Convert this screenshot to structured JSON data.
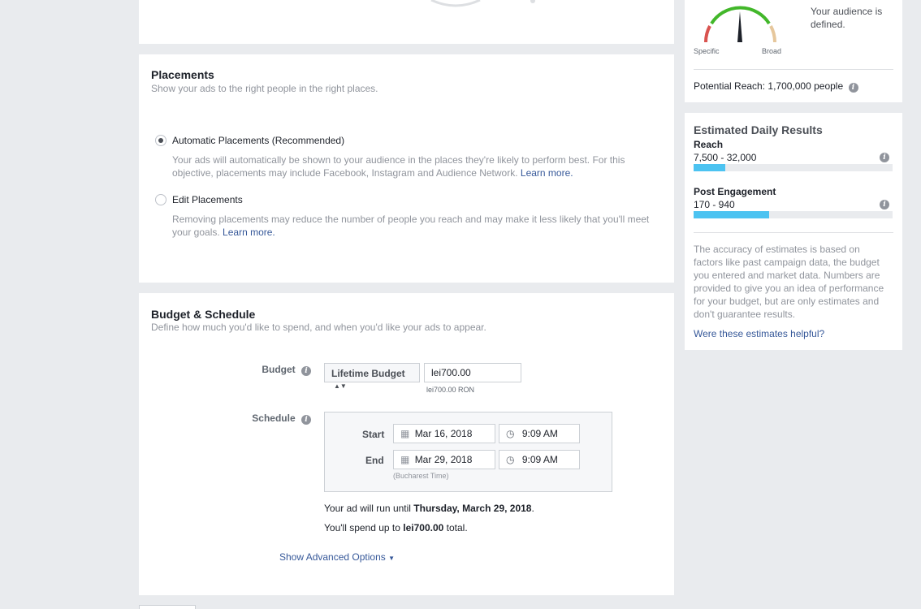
{
  "placements": {
    "title": "Placements",
    "subtitle": "Show your ads to the right people in the right places.",
    "options": [
      {
        "label": "Automatic Placements (Recommended)",
        "description": "Your ads will automatically be shown to your audience in the places they're likely to perform best. For this objective, placements may include Facebook, Instagram and Audience Network.",
        "link": "Learn more.",
        "selected": true
      },
      {
        "label": "Edit Placements",
        "description": "Removing placements may reduce the number of people you reach and may make it less likely that you'll meet your goals.",
        "link": "Learn more.",
        "selected": false
      }
    ]
  },
  "budget_schedule": {
    "title": "Budget & Schedule",
    "subtitle": "Define how much you'd like to spend, and when you'd like your ads to appear.",
    "budget_label": "Budget",
    "budget_type": "Lifetime Budget",
    "budget_value": "lei700.00",
    "budget_hint": "lei700.00 RON",
    "schedule_label": "Schedule",
    "start_label": "Start",
    "start_date": "Mar 16, 2018",
    "start_time": "9:09 AM",
    "end_label": "End",
    "end_date": "Mar 29, 2018",
    "end_time": "9:09 AM",
    "timezone": "(Bucharest Time)",
    "run_prefix": "Your ad will run until ",
    "run_date": "Thursday, March 29, 2018",
    "run_suffix": ".",
    "spend_prefix": "You'll spend up to ",
    "spend_value": "lei700.00",
    "spend_suffix": " total.",
    "advanced": "Show Advanced Options"
  },
  "audience": {
    "defined_text": "Your audience is defined.",
    "gauge_left": "Specific",
    "gauge_right": "Broad",
    "potential_reach": "Potential Reach: 1,700,000 people"
  },
  "estimates": {
    "title": "Estimated Daily Results",
    "metrics": [
      {
        "label": "Reach",
        "range": "7,500 - 32,000",
        "fill_fraction": 0.16
      },
      {
        "label": "Post Engagement",
        "range": "170 - 940",
        "fill_fraction": 0.38
      }
    ],
    "disclaimer": "The accuracy of estimates is based on factors like past campaign data, the budget you entered and market data. Numbers are provided to give you an idea of performance for your budget, but are only estimates and don't guarantee results.",
    "feedback_link": "Were these estimates helpful?"
  },
  "colors": {
    "bar_fill": "#4cc3f1",
    "link": "#365899",
    "gauge_green": "#42b72a",
    "gauge_red": "#d9534f",
    "gauge_tan": "#e6c79c"
  }
}
